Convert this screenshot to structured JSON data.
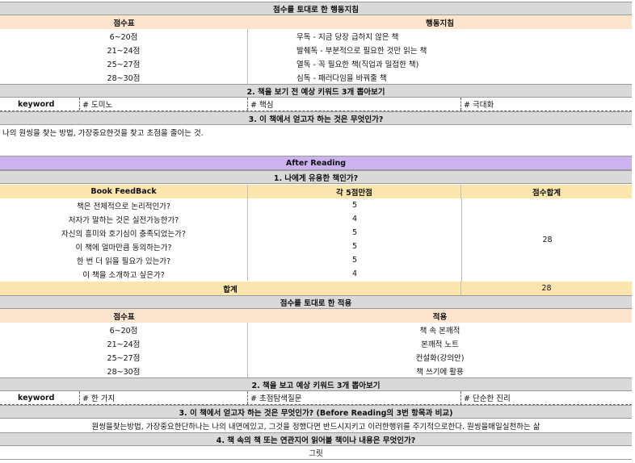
{
  "before": {
    "title": "점수를 토대로 한 행동지침",
    "score_header": "점수표",
    "action_header": "행동지침",
    "rows": [
      {
        "score": "6~20점",
        "action": "무독   - 지금 당장 급하지 않은 책"
      },
      {
        "score": "21~24점",
        "action": "발췌독 - 부분적으로 필요한 것만 읽는 책"
      },
      {
        "score": "25~27점",
        "action": "열독   - 꼭 필요한 책(직업과 밀접한 책)"
      },
      {
        "score": "28~30점",
        "action": "심독   - 패러다임을 바꿔줄 책"
      }
    ],
    "keyword_title": "2. 책을 보기 전 예상 키워드 3개 뽑아보기",
    "keyword_label": "keyword",
    "keywords": [
      "# 도미노",
      "# 핵심",
      "# 극대화"
    ],
    "q3_title": "3. 이 책에서 얻고자 하는 것은 무엇인가?",
    "q3_answer": "나의 원씽을 찾는 방법, 가장중요한것을 찾고 초점을  줄이는 것."
  },
  "after": {
    "title": "After Reading",
    "q1_title": "1. 나에게 유용한 책인가?",
    "feedback_header": "Book FeedBack",
    "points_header": "각 5점만점",
    "total_header": "점수합계",
    "feedback": [
      {
        "q": "책은 전체적으로 논리적인가?",
        "score": "5"
      },
      {
        "q": "저자가 말하는 것은 실전가능한가?",
        "score": "4"
      },
      {
        "q": "자신의 흥미와 호기심이 충족되었는가?",
        "score": "5"
      },
      {
        "q": "이 책에 얼마만큼 동의하는가?",
        "score": "5"
      },
      {
        "q": "한 번 더 읽을 필요가 있는가?",
        "score": "5"
      },
      {
        "q": "이 책을 소개하고 싶은가?",
        "score": "4"
      }
    ],
    "total_value": "28",
    "sum_label": "합계",
    "sum_value": "28",
    "apply_title": "점수를 토대로 한 적용",
    "score_header": "점수표",
    "apply_header": "적용",
    "apply_rows": [
      {
        "score": "6~20점",
        "apply": "책 속 본깨적"
      },
      {
        "score": "21~24점",
        "apply": "본깨적 노트"
      },
      {
        "score": "25~27점",
        "apply": "컨설화(강의안)"
      },
      {
        "score": "28~30점",
        "apply": "책 쓰기에 활용"
      }
    ],
    "keyword_title": "2. 책을 보고 예상 키워드 3개 뽑아보기",
    "keyword_label": "keyword",
    "keywords": [
      "# 한 가지",
      "# 초점탐색질문",
      "# 단순한 진리"
    ],
    "q3_title": "3. 이 책에서 얻고자 하는 것은 무엇인가? (Before Reading의 3번 항목과 비교)",
    "q3_answer": "원씽을찾는방법, 가장중요한단하나는 나의 내면에있고, 그것을 정했다면 반드시지키고 이러한행위를 주기적으로한다. 원씽을매일실천하는 삶",
    "q4_title": "4. 책 속의 책 또는 연관지어 읽어볼 책이나 내용은 무엇인가?",
    "q4_answer": "그릿"
  }
}
